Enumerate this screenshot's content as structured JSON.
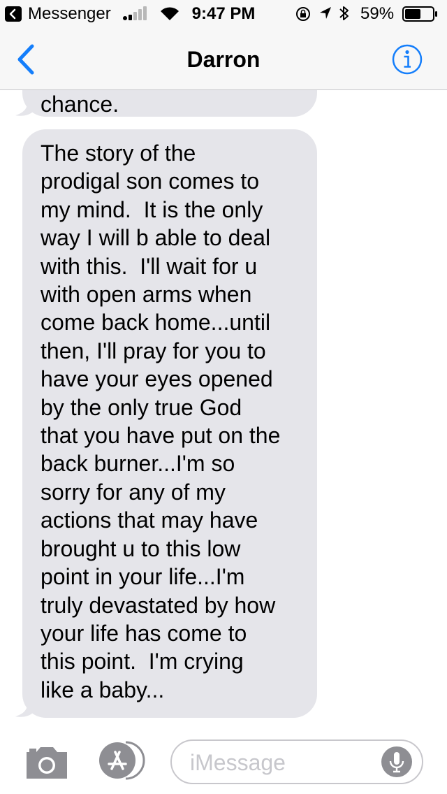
{
  "status_bar": {
    "back_app": "Messenger",
    "time": "9:47 PM",
    "battery_percent": "59%",
    "battery_level": 0.59,
    "signal_bars": 2
  },
  "header": {
    "title": "Darron",
    "back_icon": "chevron-left-icon",
    "info_icon": "info-icon"
  },
  "messages": [
    {
      "text": "chance."
    },
    {
      "text": "The story of the\nprodigal son comes to\nmy mind.  It is the only\nway I will b able to deal\nwith this.  I'll wait for u\nwith open arms when\ncome back home...until\nthen, I'll pray for you to\nhave your eyes opened\nby the only true God\nthat you have put on the\nback burner...I'm so\nsorry for any of my\nactions that may have\nbrought u to this low\npoint in your life...I'm\ntruly devastated by how\nyour life has come to\nthis point.  I'm crying\nlike a baby..."
    }
  ],
  "input_bar": {
    "placeholder": "iMessage",
    "camera_icon": "camera-icon",
    "apps_icon": "app-store-icon",
    "mic_icon": "microphone-icon"
  },
  "colors": {
    "accent": "#147efb",
    "bubble_received": "#e5e5ea",
    "bar_background": "#f7f7f7"
  }
}
